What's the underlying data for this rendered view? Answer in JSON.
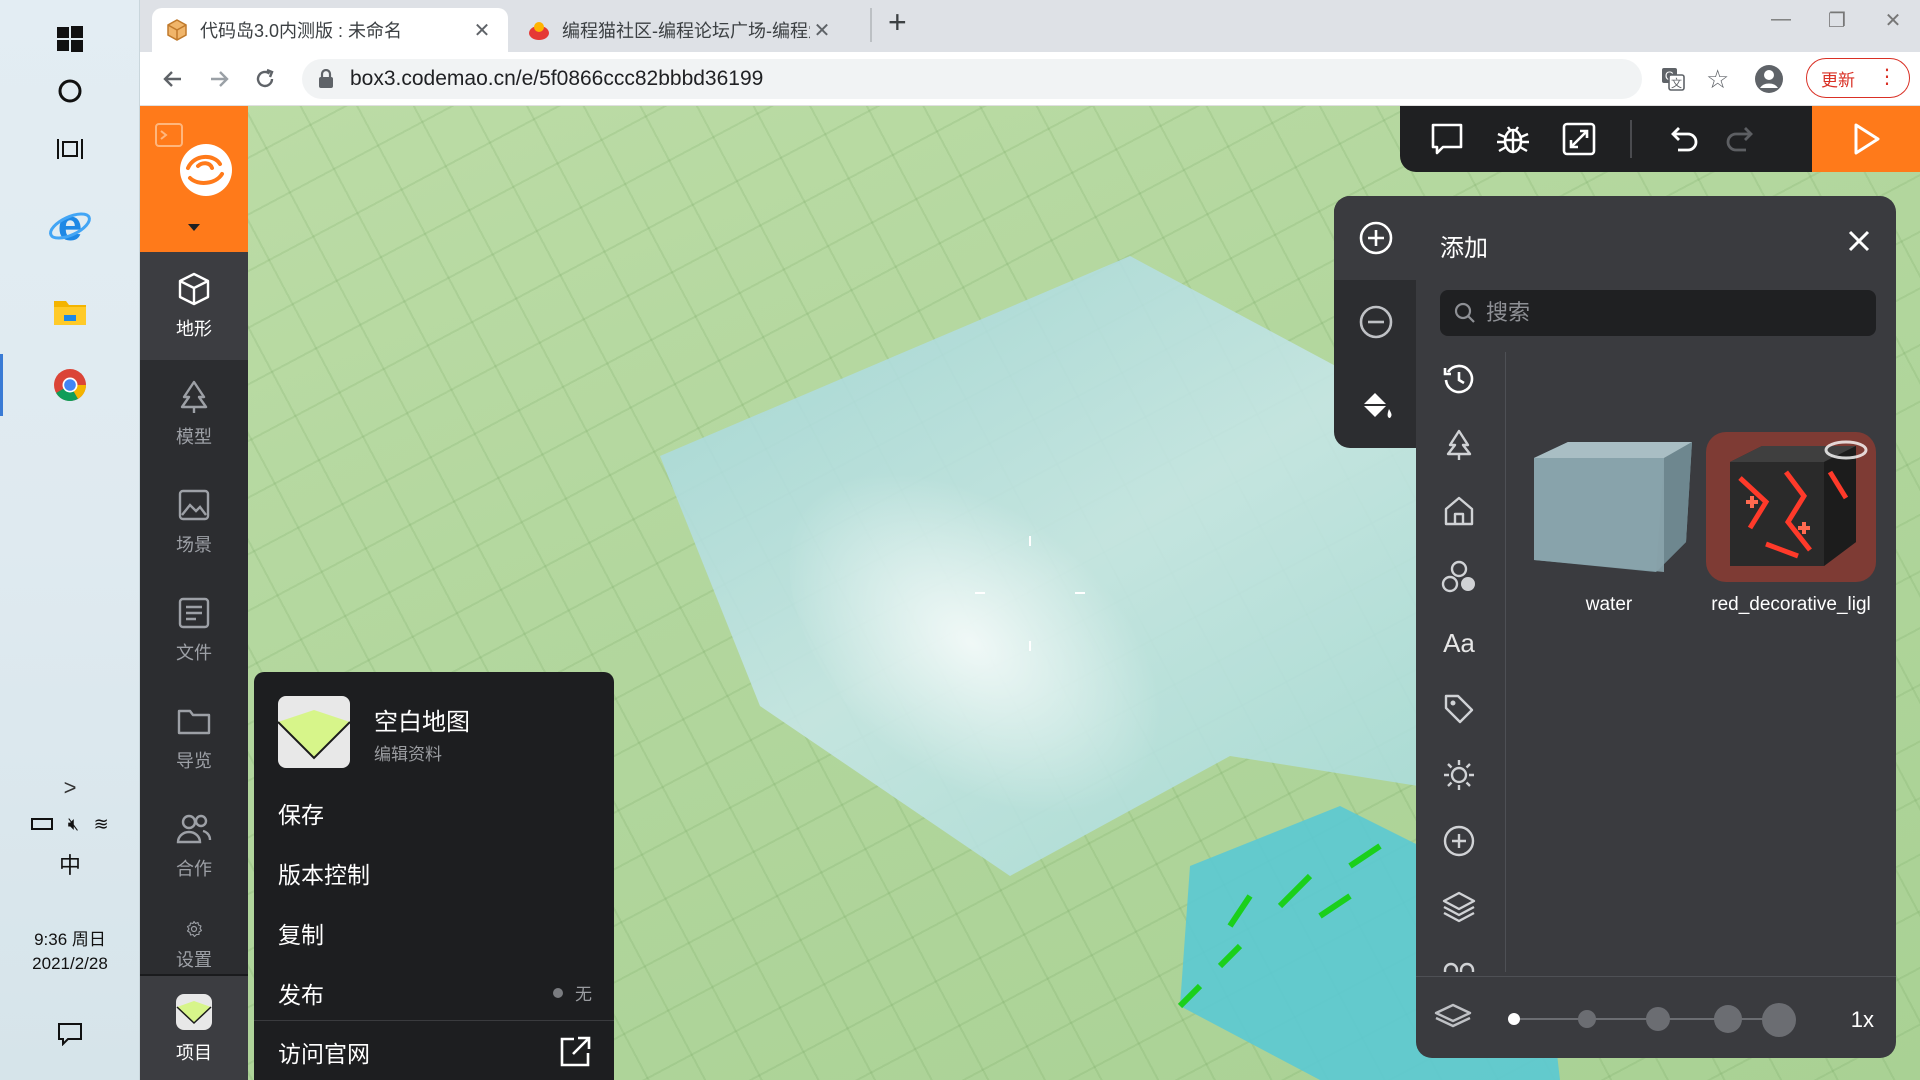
{
  "taskbar": {
    "tray_chevron": ">",
    "ime": "中",
    "time": "9:36 周日",
    "date": "2021/2/28"
  },
  "browser": {
    "tabs": [
      {
        "title": "代码岛3.0内测版 : 未命名",
        "active": true
      },
      {
        "title": "编程猫社区-编程论坛广场-编程爱",
        "active": false
      }
    ],
    "new_tab": "+",
    "url": "box3.codemao.cn/e/5f0866ccc82bbbd36199",
    "update_label": "更新"
  },
  "sidebar": {
    "items": [
      {
        "label": "地形",
        "icon": "cube-icon",
        "active": true
      },
      {
        "label": "模型",
        "icon": "tree-icon",
        "active": false
      },
      {
        "label": "场景",
        "icon": "image-icon",
        "active": false
      },
      {
        "label": "文件",
        "icon": "file-list-icon",
        "active": false
      },
      {
        "label": "导览",
        "icon": "folder-icon",
        "active": false
      },
      {
        "label": "合作",
        "icon": "users-icon",
        "active": false
      },
      {
        "label": "设置",
        "icon": "gear-icon",
        "active": false
      }
    ],
    "project_label": "项目"
  },
  "project_menu": {
    "title": "空白地图",
    "subtitle": "编辑资料",
    "items": [
      "保存",
      "版本控制",
      "复制",
      "发布",
      "访问官网"
    ],
    "publish_state": "无"
  },
  "add_panel": {
    "title": "添加",
    "search_placeholder": "搜索",
    "categories": [
      "history-icon",
      "tree-icon",
      "home-icon",
      "shapes-icon",
      "text-aa-icon",
      "tag-icon",
      "sun-icon",
      "plus-circle-icon",
      "layers-icon",
      "link-icon"
    ],
    "text_cat_label": "Aa",
    "blocks": [
      {
        "name": "water"
      },
      {
        "name": "red_decorative_ligl"
      }
    ],
    "zoom_label": "1x"
  },
  "colors": {
    "accent": "#ff7a1a",
    "panel_dark": "#2c2d30",
    "panel": "#3a3b3f",
    "grass": "#b3d79e",
    "water": "#8fd3d9"
  }
}
